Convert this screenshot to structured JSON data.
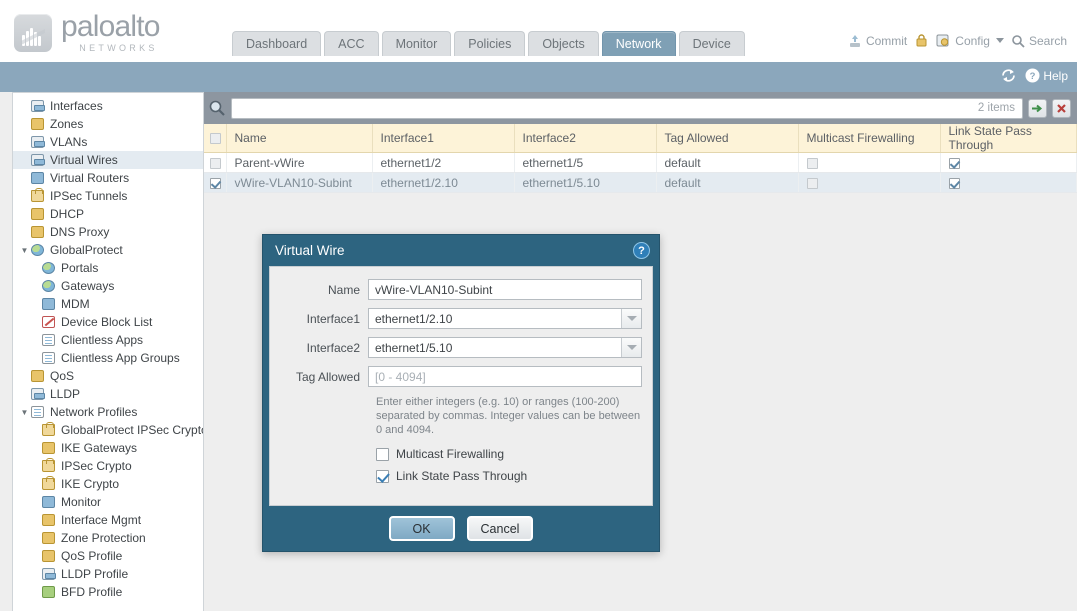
{
  "brand": {
    "name": "paloalto",
    "tagline": "NETWORKS"
  },
  "nav": {
    "tabs": [
      {
        "label": "Dashboard",
        "active": false
      },
      {
        "label": "ACC",
        "active": false
      },
      {
        "label": "Monitor",
        "active": false
      },
      {
        "label": "Policies",
        "active": false
      },
      {
        "label": "Objects",
        "active": false
      },
      {
        "label": "Network",
        "active": true
      },
      {
        "label": "Device",
        "active": false
      }
    ]
  },
  "top_actions": {
    "commit": "Commit",
    "config": "Config",
    "search": "Search"
  },
  "band": {
    "refresh": "refresh-icon",
    "help": "Help"
  },
  "sidebar": {
    "items": [
      {
        "label": "Interfaces",
        "icon": "interfaces-icon",
        "indent": 0,
        "group": false,
        "selected": false,
        "ic": "ic-net"
      },
      {
        "label": "Zones",
        "icon": "zones-icon",
        "indent": 0,
        "group": false,
        "selected": false,
        "ic": "ic-gold"
      },
      {
        "label": "VLANs",
        "icon": "vlans-icon",
        "indent": 0,
        "group": false,
        "selected": false,
        "ic": "ic-net"
      },
      {
        "label": "Virtual Wires",
        "icon": "virtual-wires-icon",
        "indent": 0,
        "group": false,
        "selected": true,
        "ic": "ic-net"
      },
      {
        "label": "Virtual Routers",
        "icon": "virtual-routers-icon",
        "indent": 0,
        "group": false,
        "selected": false,
        "ic": "ic-blue"
      },
      {
        "label": "IPSec Tunnels",
        "icon": "ipsec-tunnels-icon",
        "indent": 0,
        "group": false,
        "selected": false,
        "ic": "ic-lock"
      },
      {
        "label": "DHCP",
        "icon": "dhcp-icon",
        "indent": 0,
        "group": false,
        "selected": false,
        "ic": "ic-gold"
      },
      {
        "label": "DNS Proxy",
        "icon": "dns-proxy-icon",
        "indent": 0,
        "group": false,
        "selected": false,
        "ic": "ic-gold"
      },
      {
        "label": "GlobalProtect",
        "icon": "globalprotect-icon",
        "indent": 0,
        "group": true,
        "selected": false,
        "ic": "ic-globe"
      },
      {
        "label": "Portals",
        "icon": "portals-icon",
        "indent": 1,
        "group": false,
        "selected": false,
        "ic": "ic-globe"
      },
      {
        "label": "Gateways",
        "icon": "gateways-icon",
        "indent": 1,
        "group": false,
        "selected": false,
        "ic": "ic-globe"
      },
      {
        "label": "MDM",
        "icon": "mdm-icon",
        "indent": 1,
        "group": false,
        "selected": false,
        "ic": "ic-blue"
      },
      {
        "label": "Device Block List",
        "icon": "device-block-list-icon",
        "indent": 1,
        "group": false,
        "selected": false,
        "ic": "ic-red"
      },
      {
        "label": "Clientless Apps",
        "icon": "clientless-apps-icon",
        "indent": 1,
        "group": false,
        "selected": false,
        "ic": "ic-doc"
      },
      {
        "label": "Clientless App Groups",
        "icon": "clientless-app-groups-icon",
        "indent": 1,
        "group": false,
        "selected": false,
        "ic": "ic-doc"
      },
      {
        "label": "QoS",
        "icon": "qos-icon",
        "indent": 0,
        "group": false,
        "selected": false,
        "ic": "ic-gold"
      },
      {
        "label": "LLDP",
        "icon": "lldp-icon",
        "indent": 0,
        "group": false,
        "selected": false,
        "ic": "ic-net"
      },
      {
        "label": "Network Profiles",
        "icon": "network-profiles-icon",
        "indent": 0,
        "group": true,
        "selected": false,
        "ic": "ic-doc"
      },
      {
        "label": "GlobalProtect IPSec Crypto",
        "icon": "globalprotect-ipsec-crypto-icon",
        "indent": 1,
        "group": false,
        "selected": false,
        "ic": "ic-lock"
      },
      {
        "label": "IKE Gateways",
        "icon": "ike-gateways-icon",
        "indent": 1,
        "group": false,
        "selected": false,
        "ic": "ic-gold"
      },
      {
        "label": "IPSec Crypto",
        "icon": "ipsec-crypto-icon",
        "indent": 1,
        "group": false,
        "selected": false,
        "ic": "ic-lock"
      },
      {
        "label": "IKE Crypto",
        "icon": "ike-crypto-icon",
        "indent": 1,
        "group": false,
        "selected": false,
        "ic": "ic-lock"
      },
      {
        "label": "Monitor",
        "icon": "monitor-icon",
        "indent": 1,
        "group": false,
        "selected": false,
        "ic": "ic-blue"
      },
      {
        "label": "Interface Mgmt",
        "icon": "interface-mgmt-icon",
        "indent": 1,
        "group": false,
        "selected": false,
        "ic": "ic-gold"
      },
      {
        "label": "Zone Protection",
        "icon": "zone-protection-icon",
        "indent": 1,
        "group": false,
        "selected": false,
        "ic": "ic-gold"
      },
      {
        "label": "QoS Profile",
        "icon": "qos-profile-icon",
        "indent": 1,
        "group": false,
        "selected": false,
        "ic": "ic-gold"
      },
      {
        "label": "LLDP Profile",
        "icon": "lldp-profile-icon",
        "indent": 1,
        "group": false,
        "selected": false,
        "ic": "ic-net"
      },
      {
        "label": "BFD Profile",
        "icon": "bfd-profile-icon",
        "indent": 1,
        "group": false,
        "selected": false,
        "ic": "ic-green"
      }
    ]
  },
  "search": {
    "value": "",
    "placeholder": "",
    "items_count": "2 items",
    "apply_icon": "arrow-right-icon",
    "clear_icon": "clear-x-icon"
  },
  "table": {
    "columns": [
      "Name",
      "Interface1",
      "Interface2",
      "Tag Allowed",
      "Multicast Firewalling",
      "Link State Pass Through"
    ],
    "rows": [
      {
        "selected": false,
        "checked": false,
        "name": "Parent-vWire",
        "interface1": "ethernet1/2",
        "interface2": "ethernet1/5",
        "tag_allowed": "default",
        "multicast_firewalling": false,
        "link_state_pass_through": true
      },
      {
        "selected": true,
        "checked": true,
        "name": "vWire-VLAN10-Subint",
        "interface1": "ethernet1/2.10",
        "interface2": "ethernet1/5.10",
        "tag_allowed": "default",
        "multicast_firewalling": false,
        "link_state_pass_through": true
      }
    ]
  },
  "dialog": {
    "title": "Virtual Wire",
    "help_icon": "?",
    "fields": {
      "name_label": "Name",
      "name_value": "vWire-VLAN10-Subint",
      "interface1_label": "Interface1",
      "interface1_value": "ethernet1/2.10",
      "interface2_label": "Interface2",
      "interface2_value": "ethernet1/5.10",
      "tag_label": "Tag Allowed",
      "tag_value": "",
      "tag_placeholder": "[0 - 4094]",
      "tag_hint": "Enter either integers (e.g. 10) or ranges (100-200) separated by commas. Integer values can be between 0 and 4094."
    },
    "checkboxes": [
      {
        "label": "Multicast Firewalling",
        "checked": false
      },
      {
        "label": "Link State Pass Through",
        "checked": true
      }
    ],
    "ok_label": "OK",
    "cancel_label": "Cancel"
  },
  "colors": {
    "accent_blue": "#8ba7bc",
    "dialog_frame": "#2d6480",
    "tab_active": "#7fa0b5",
    "header_yellow": "#fdf3d8",
    "selection": "#e4ebf1"
  }
}
